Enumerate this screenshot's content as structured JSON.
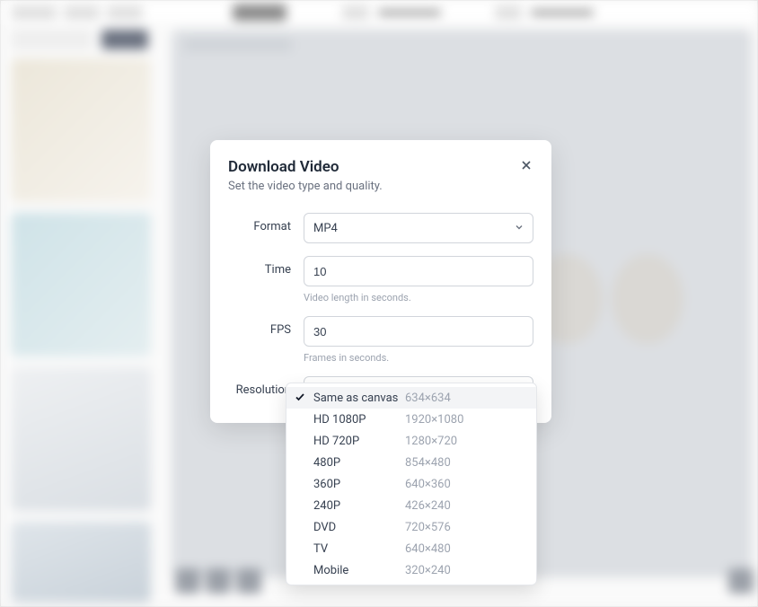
{
  "modal": {
    "title": "Download Video",
    "subtitle": "Set the video type and quality.",
    "close_aria": "Close"
  },
  "format": {
    "label": "Format",
    "value": "MP4"
  },
  "time": {
    "label": "Time",
    "value": "10",
    "hint": "Video length in seconds."
  },
  "fps": {
    "label": "FPS",
    "value": "30",
    "hint": "Frames in seconds."
  },
  "resolution": {
    "label": "Resolution",
    "selected_label": "Same as canvas",
    "selected_dim": "634×634",
    "options": [
      {
        "label": "Same as canvas",
        "dim": "634×634",
        "selected": true
      },
      {
        "label": "HD 1080P",
        "dim": "1920×1080"
      },
      {
        "label": "HD 720P",
        "dim": "1280×720"
      },
      {
        "label": "480P",
        "dim": "854×480"
      },
      {
        "label": "360P",
        "dim": "640×360"
      },
      {
        "label": "240P",
        "dim": "426×240"
      },
      {
        "label": "DVD",
        "dim": "720×576"
      },
      {
        "label": "TV",
        "dim": "640×480"
      },
      {
        "label": "Mobile",
        "dim": "320×240"
      }
    ]
  }
}
